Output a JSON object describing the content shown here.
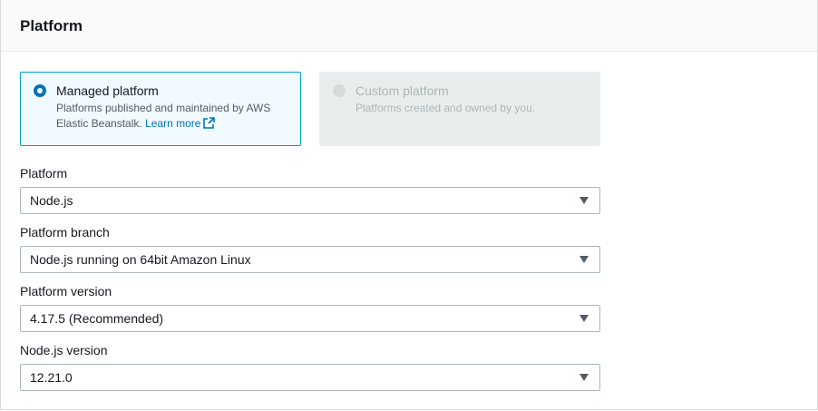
{
  "section": {
    "title": "Platform"
  },
  "platform_type": {
    "managed": {
      "title": "Managed platform",
      "description": "Platforms published and maintained by AWS Elastic Beanstalk.",
      "link": "Learn more",
      "selected": true
    },
    "custom": {
      "title": "Custom platform",
      "description": "Platforms created and owned by you.",
      "disabled": true
    }
  },
  "fields": {
    "platform": {
      "label": "Platform",
      "value": "Node.js"
    },
    "branch": {
      "label": "Platform branch",
      "value": "Node.js running on 64bit Amazon Linux"
    },
    "version": {
      "label": "Platform version",
      "value": "4.17.5 (Recommended)"
    },
    "node_version": {
      "label": "Node.js version",
      "value": "12.21.0"
    }
  },
  "colors": {
    "accent": "#0073bb",
    "selected_border": "#00a1c9",
    "selected_bg": "#f1faff",
    "disabled_bg": "#eaeded"
  }
}
